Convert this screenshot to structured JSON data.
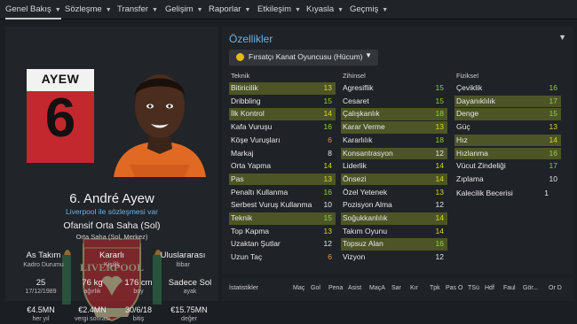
{
  "nav": {
    "items": [
      {
        "label": "Genel Bakış",
        "active": true
      },
      {
        "label": "Sözleşme"
      },
      {
        "label": "Transfer"
      },
      {
        "label": "Gelişim"
      },
      {
        "label": "Raporlar"
      },
      {
        "label": "Etkileşim"
      },
      {
        "label": "Kıyasla"
      },
      {
        "label": "Geçmiş"
      }
    ]
  },
  "player": {
    "shirt_name": "AYEW",
    "shirt_number": "6",
    "full_name": "6. André Ayew",
    "contract": "Liverpool ile sözleşmesi var",
    "position": "Ofansif Orta Saha (Sol)",
    "sub_position": "Orta Saha (Sol, Merkez)",
    "kit_colors": {
      "shirt": "#c3282f",
      "band": "#f2f2f2"
    }
  },
  "stats": {
    "status": {
      "value": "As Takım",
      "label": "Kadro Durumu"
    },
    "personality": {
      "value": "Kararlı",
      "label": "Kişilik"
    },
    "reputation": {
      "value": "Uluslararası",
      "label": "İtibar"
    },
    "age": {
      "value": "25",
      "label": "17/12/1989"
    },
    "weight": {
      "value": "76 kg",
      "label": "ağırlık"
    },
    "height": {
      "value": "176 cm",
      "label": "boy"
    },
    "foot": {
      "value": "Sadece Sol",
      "label": "ayak"
    },
    "wage": {
      "value": "€4.5MN",
      "label": "her yıl"
    },
    "after_tax": {
      "value": "€2.4MN",
      "label": "vergi sonrası"
    },
    "contract_end": {
      "value": "30/6/18",
      "label": "bitiş"
    },
    "value": {
      "value": "€15.75MN",
      "label": "değer"
    }
  },
  "attributes": {
    "title": "Özellikler",
    "role": "Fırsatçı Kanat Oyuncusu (Hücum)",
    "technical": {
      "title": "Teknik",
      "items": [
        {
          "name": "Bitiricilik",
          "value": "13",
          "hl": true
        },
        {
          "name": "Dribbling",
          "value": "15",
          "hl": false
        },
        {
          "name": "İlk Kontrol",
          "value": "14",
          "hl": true
        },
        {
          "name": "Kafa Vuruşu",
          "value": "16",
          "hl": false
        },
        {
          "name": "Köşe Vuruşları",
          "value": "6",
          "hl": false
        },
        {
          "name": "Markaj",
          "value": "8",
          "hl": false
        },
        {
          "name": "Orta Yapma",
          "value": "14",
          "hl": false
        },
        {
          "name": "Pas",
          "value": "13",
          "hl": true
        },
        {
          "name": "Penaltı Kullanma",
          "value": "16",
          "hl": false
        },
        {
          "name": "Serbest Vuruş Kullanma",
          "value": "10",
          "hl": false
        },
        {
          "name": "Teknik",
          "value": "15",
          "hl": true
        },
        {
          "name": "Top Kapma",
          "value": "13",
          "hl": false
        },
        {
          "name": "Uzaktan Şutlar",
          "value": "12",
          "hl": false
        },
        {
          "name": "Uzun Taç",
          "value": "6",
          "hl": false
        }
      ]
    },
    "mental": {
      "title": "Zihinsel",
      "items": [
        {
          "name": "Agresiflik",
          "value": "15",
          "hl": false
        },
        {
          "name": "Cesaret",
          "value": "15",
          "hl": false
        },
        {
          "name": "Çalışkanlık",
          "value": "18",
          "hl": true
        },
        {
          "name": "Karar Verme",
          "value": "13",
          "hl": true
        },
        {
          "name": "Kararlılık",
          "value": "18",
          "hl": false
        },
        {
          "name": "Konsantrasyon",
          "value": "12",
          "hl": true
        },
        {
          "name": "Liderlik",
          "value": "14",
          "hl": false
        },
        {
          "name": "Önsezi",
          "value": "14",
          "hl": true
        },
        {
          "name": "Özel Yetenek",
          "value": "13",
          "hl": false
        },
        {
          "name": "Pozisyon Alma",
          "value": "12",
          "hl": false
        },
        {
          "name": "Soğukkanlılık",
          "value": "14",
          "hl": true
        },
        {
          "name": "Takım Oyunu",
          "value": "14",
          "hl": false
        },
        {
          "name": "Topsuz Alan",
          "value": "16",
          "hl": true
        },
        {
          "name": "Vizyon",
          "value": "12",
          "hl": false
        }
      ]
    },
    "physical": {
      "title": "Fiziksel",
      "items": [
        {
          "name": "Çeviklik",
          "value": "16",
          "hl": false
        },
        {
          "name": "Dayanıklılık",
          "value": "17",
          "hl": true
        },
        {
          "name": "Denge",
          "value": "15",
          "hl": true
        },
        {
          "name": "Güç",
          "value": "13",
          "hl": false
        },
        {
          "name": "Hız",
          "value": "14",
          "hl": true
        },
        {
          "name": "Hızlanma",
          "value": "16",
          "hl": true
        },
        {
          "name": "Vücut Zindeliği",
          "value": "17",
          "hl": false
        },
        {
          "name": "Zıplama",
          "value": "10",
          "hl": false
        }
      ]
    },
    "extra": {
      "name": "Kalecilik Becerisi",
      "value": "1"
    }
  },
  "statistics": {
    "title": "İstatistikler",
    "columns": [
      "Maç",
      "Gol",
      "Pena",
      "Asist",
      "MaçA",
      "Sar",
      "Kır",
      "Tpk",
      "Pas O",
      "TSü",
      "Hdf",
      "Faul",
      "Gör...",
      "Or D"
    ]
  }
}
